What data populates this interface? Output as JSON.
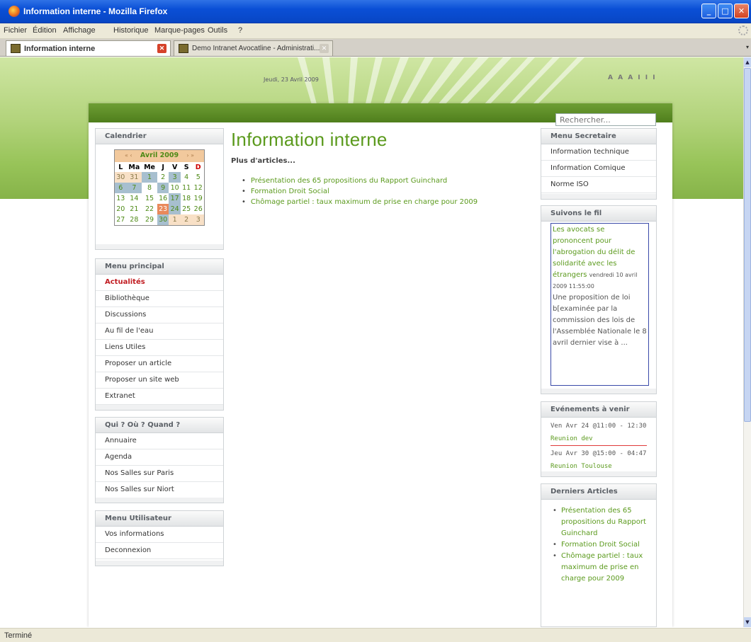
{
  "window": {
    "title": "Information interne - Mozilla Firefox"
  },
  "menubar": [
    "Fichier",
    "Édition",
    "Affichage",
    "Historique",
    "Marque-pages",
    "Outils",
    "?"
  ],
  "tabs": [
    {
      "label": "Information interne",
      "active": true
    },
    {
      "label": "Demo Intranet Avocatline - Administrati...",
      "active": false
    }
  ],
  "header": {
    "date": "Jeudi, 23 Avril 2009",
    "text_size": "A A A I I I"
  },
  "search": {
    "placeholder": "Rechercher..."
  },
  "calendar": {
    "title": "Calendrier",
    "month": "Avril 2009",
    "nav_prev": "« ‹",
    "nav_next": "› »",
    "days": [
      "L",
      "Ma",
      "Me",
      "J",
      "V",
      "S",
      "D"
    ],
    "weeks": [
      [
        "30",
        "31",
        "1",
        "2",
        "3",
        "4",
        "5"
      ],
      [
        "6",
        "7",
        "8",
        "9",
        "10",
        "11",
        "12"
      ],
      [
        "13",
        "14",
        "15",
        "16",
        "17",
        "18",
        "19"
      ],
      [
        "20",
        "21",
        "22",
        "23",
        "24",
        "25",
        "26"
      ],
      [
        "27",
        "28",
        "29",
        "30",
        "1",
        "2",
        "3"
      ]
    ]
  },
  "menu_principal": {
    "title": "Menu principal",
    "items": [
      "Actualités",
      "Bibliothèque",
      "Discussions",
      "Au fil de l'eau",
      "Liens Utiles",
      "Proposer un article",
      "Proposer un site web",
      "Extranet"
    ]
  },
  "menu_qui": {
    "title": "Qui ? Où ? Quand ?",
    "items": [
      "Annuaire",
      "Agenda",
      "Nos Salles sur Paris",
      "Nos Salles sur Niort"
    ]
  },
  "menu_utilisateur": {
    "title": "Menu Utilisateur",
    "items": [
      "Vos informations",
      "Deconnexion"
    ]
  },
  "main": {
    "title": "Information interne",
    "more": "Plus d'articles...",
    "articles": [
      "Présentation des 65 propositions du Rapport Guinchard",
      "Formation Droit Social",
      "Chômage partiel : taux maximum de prise en charge pour 2009"
    ]
  },
  "menu_secretaire": {
    "title": "Menu Secretaire",
    "items": [
      "Information technique",
      "Information Comique",
      "Norme ISO"
    ]
  },
  "suivons": {
    "title": "Suivons le fil",
    "link": "Les avocats se prononcent pour l'abrogation du délit de solidarité avec les étrangers",
    "date": "vendredi 10 avril 2009 11:55:00",
    "text": "Une proposition de loi b[examinée par la commission des lois de l'Assemblée Nationale le 8 avril dernier vise à ..."
  },
  "evenements": {
    "title": "Evénements à venir",
    "items": [
      {
        "date": "Ven Avr 24 @11:00 - 12:30",
        "title": "Reunion dev"
      },
      {
        "date": "Jeu Avr 30 @15:00 - 04:47",
        "title": "Reunion Toulouse"
      }
    ]
  },
  "derniers": {
    "title": "Derniers Articles",
    "items": [
      "Présentation des 65 propositions du Rapport Guinchard",
      "Formation Droit Social",
      "Chômage partiel : taux maximum de prise en charge pour 2009"
    ]
  },
  "status": "Terminé"
}
